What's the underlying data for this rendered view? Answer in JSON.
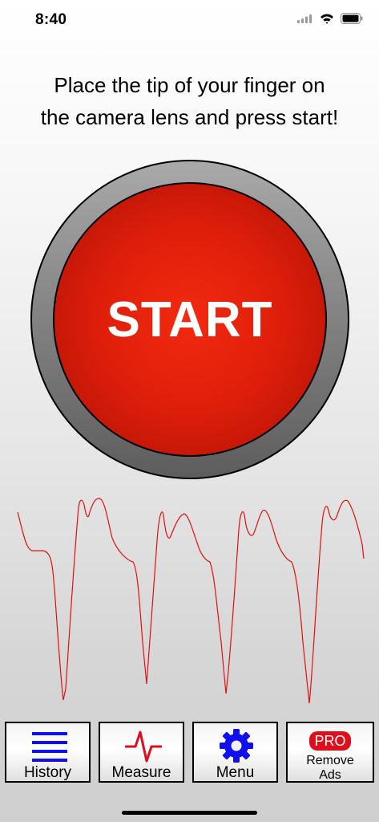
{
  "status_bar": {
    "time": "8:40",
    "icons": [
      "signal-icon",
      "wifi-icon",
      "battery-icon"
    ]
  },
  "instruction": {
    "line1": "Place the tip of your finger on",
    "line2": "the camera lens and press start!"
  },
  "start_button": {
    "label": "START",
    "color": "#e01f0b"
  },
  "waveform": {
    "color": "#e0100d",
    "icon": "pulse-waveform"
  },
  "tab_bar": {
    "tabs": [
      {
        "label": "History",
        "icon": "list-icon",
        "icon_color": "#1010ee"
      },
      {
        "label": "Measure",
        "icon": "heartbeat-icon",
        "icon_color": "#e00d1d"
      },
      {
        "label": "Menu",
        "icon": "gear-icon",
        "icon_color": "#1010ee"
      },
      {
        "label": "Remove\nAds",
        "badge": "PRO",
        "badge_color": "#e00d1d"
      }
    ],
    "remove_ads": {
      "line1": "Remove",
      "line2": "Ads"
    }
  }
}
